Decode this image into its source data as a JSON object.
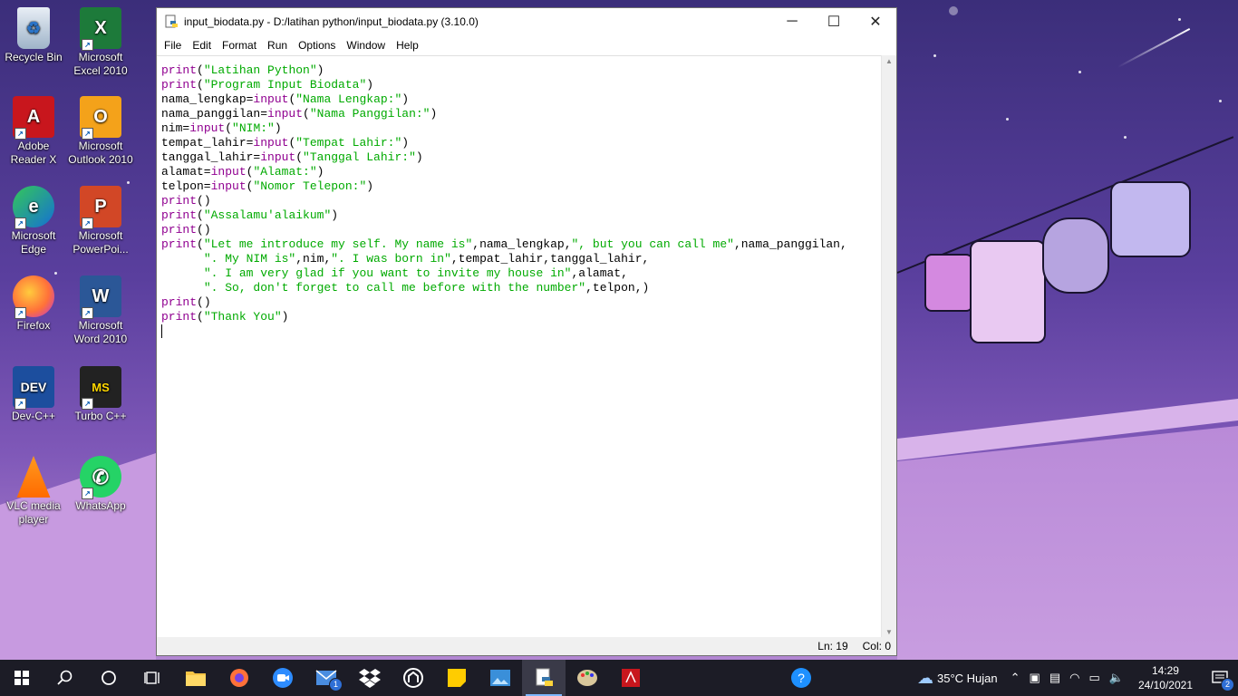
{
  "desktop": {
    "icons": [
      {
        "label": "Recycle Bin"
      },
      {
        "label": "Microsoft Excel 2010"
      },
      {
        "label": "Adobe Reader X"
      },
      {
        "label": "Microsoft Outlook 2010"
      },
      {
        "label": "Microsoft Edge"
      },
      {
        "label": "Microsoft PowerPoi..."
      },
      {
        "label": "Firefox"
      },
      {
        "label": "Microsoft Word 2010"
      },
      {
        "label": "Dev-C++"
      },
      {
        "label": "Turbo C++"
      },
      {
        "label": "VLC media player"
      },
      {
        "label": "WhatsApp"
      }
    ]
  },
  "window": {
    "title": "input_biodata.py - D:/latihan python/input_biodata.py (3.10.0)",
    "minimize": "─",
    "maximize": "☐",
    "close": "✕",
    "menu": [
      "File",
      "Edit",
      "Format",
      "Run",
      "Options",
      "Window",
      "Help"
    ]
  },
  "code": {
    "lines": [
      [
        [
          "kw",
          "print"
        ],
        [
          "p",
          "("
        ],
        [
          "s",
          "\"Latihan Python\""
        ],
        [
          "p",
          ")"
        ]
      ],
      [
        [
          "kw",
          "print"
        ],
        [
          "p",
          "("
        ],
        [
          "s",
          "\"Program Input Biodata\""
        ],
        [
          "p",
          ")"
        ]
      ],
      [
        [
          "p",
          "nama_lengkap="
        ],
        [
          "kw",
          "input"
        ],
        [
          "p",
          "("
        ],
        [
          "s",
          "\"Nama Lengkap:\""
        ],
        [
          "p",
          ")"
        ]
      ],
      [
        [
          "p",
          "nama_panggilan="
        ],
        [
          "kw",
          "input"
        ],
        [
          "p",
          "("
        ],
        [
          "s",
          "\"Nama Panggilan:\""
        ],
        [
          "p",
          ")"
        ]
      ],
      [
        [
          "p",
          "nim="
        ],
        [
          "kw",
          "input"
        ],
        [
          "p",
          "("
        ],
        [
          "s",
          "\"NIM:\""
        ],
        [
          "p",
          ")"
        ]
      ],
      [
        [
          "p",
          "tempat_lahir="
        ],
        [
          "kw",
          "input"
        ],
        [
          "p",
          "("
        ],
        [
          "s",
          "\"Tempat Lahir:\""
        ],
        [
          "p",
          ")"
        ]
      ],
      [
        [
          "p",
          "tanggal_lahir="
        ],
        [
          "kw",
          "input"
        ],
        [
          "p",
          "("
        ],
        [
          "s",
          "\"Tanggal Lahir:\""
        ],
        [
          "p",
          ")"
        ]
      ],
      [
        [
          "p",
          "alamat="
        ],
        [
          "kw",
          "input"
        ],
        [
          "p",
          "("
        ],
        [
          "s",
          "\"Alamat:\""
        ],
        [
          "p",
          ")"
        ]
      ],
      [
        [
          "p",
          "telpon="
        ],
        [
          "kw",
          "input"
        ],
        [
          "p",
          "("
        ],
        [
          "s",
          "\"Nomor Telepon:\""
        ],
        [
          "p",
          ")"
        ]
      ],
      [
        [
          "kw",
          "print"
        ],
        [
          "p",
          "()"
        ]
      ],
      [
        [
          "kw",
          "print"
        ],
        [
          "p",
          "("
        ],
        [
          "s",
          "\"Assalamu'alaikum\""
        ],
        [
          "p",
          ")"
        ]
      ],
      [
        [
          "kw",
          "print"
        ],
        [
          "p",
          "()"
        ]
      ],
      [
        [
          "kw",
          "print"
        ],
        [
          "p",
          "("
        ],
        [
          "s",
          "\"Let me introduce my self. My name is\""
        ],
        [
          "p",
          ",nama_lengkap,"
        ],
        [
          "s",
          "\", but you can call me\""
        ],
        [
          "p",
          ",nama_panggilan,"
        ]
      ],
      [
        [
          "p",
          "      "
        ],
        [
          "s",
          "\". My NIM is\""
        ],
        [
          "p",
          ",nim,"
        ],
        [
          "s",
          "\". I was born in\""
        ],
        [
          "p",
          ",tempat_lahir,tanggal_lahir,"
        ]
      ],
      [
        [
          "p",
          "      "
        ],
        [
          "s",
          "\". I am very glad if you want to invite my house in\""
        ],
        [
          "p",
          ",alamat,"
        ]
      ],
      [
        [
          "p",
          "      "
        ],
        [
          "s",
          "\". So, don't forget to call me before with the number\""
        ],
        [
          "p",
          ",telpon,)"
        ]
      ],
      [
        [
          "kw",
          "print"
        ],
        [
          "p",
          "()"
        ]
      ],
      [
        [
          "kw",
          "print"
        ],
        [
          "p",
          "("
        ],
        [
          "s",
          "\"Thank You\""
        ],
        [
          "p",
          ")"
        ]
      ],
      []
    ]
  },
  "status": {
    "line": "Ln: 19",
    "col": "Col: 0"
  },
  "taskbar": {
    "weather": "35°C Hujan",
    "time": "14:29",
    "date": "24/10/2021",
    "mail_badge": "1",
    "notif_badge": "2"
  },
  "colors": {
    "keyword": "#900090",
    "string": "#00aa00",
    "taskbar": "#1c1c26"
  }
}
